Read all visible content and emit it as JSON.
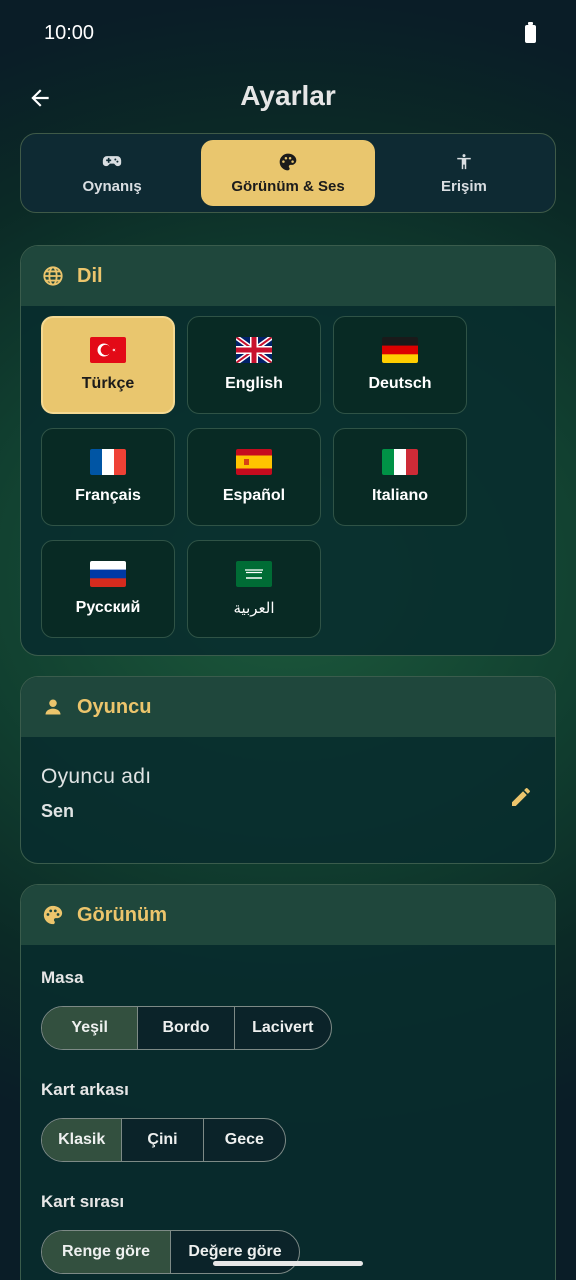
{
  "status_bar": {
    "time": "10:00"
  },
  "header": {
    "title": "Ayarlar",
    "back_icon": "arrow-left-icon"
  },
  "tabs": [
    {
      "label": "Oynanış",
      "icon": "gamepad-icon",
      "active": false
    },
    {
      "label": "Görünüm & Ses",
      "icon": "palette-icon",
      "active": true
    },
    {
      "label": "Erişim",
      "icon": "accessibility-icon",
      "active": false
    }
  ],
  "language": {
    "title": "Dil",
    "icon": "globe-icon",
    "items": [
      {
        "label": "Türkçe",
        "flag": "turkey-flag",
        "active": true
      },
      {
        "label": "English",
        "flag": "uk-flag",
        "active": false
      },
      {
        "label": "Deutsch",
        "flag": "germany-flag",
        "active": false
      },
      {
        "label": "Français",
        "flag": "france-flag",
        "active": false
      },
      {
        "label": "Español",
        "flag": "spain-flag",
        "active": false
      },
      {
        "label": "Italiano",
        "flag": "italy-flag",
        "active": false
      },
      {
        "label": "Русский",
        "flag": "russia-flag",
        "active": false
      },
      {
        "label": "العربية",
        "flag": "saudi-flag",
        "active": false
      }
    ]
  },
  "player": {
    "title": "Oyuncu",
    "icon": "person-icon",
    "name_label": "Oyuncu adı",
    "name_value": "Sen",
    "edit_icon": "pencil-icon"
  },
  "appearance": {
    "title": "Görünüm",
    "icon": "palette-icon",
    "table": {
      "label": "Masa",
      "options": [
        "Yeşil",
        "Bordo",
        "Lacivert"
      ],
      "selected": "Yeşil"
    },
    "card_back": {
      "label": "Kart arkası",
      "options": [
        "Klasik",
        "Çini",
        "Gece"
      ],
      "selected": "Klasik"
    },
    "card_order": {
      "label": "Kart sırası",
      "options": [
        "Renge göre",
        "Değere göre"
      ],
      "selected": "Renge göre"
    }
  },
  "colors": {
    "accent": "#e9c66e",
    "accent_text": "#ecc56c",
    "background": "#114030",
    "card_header": "#1f473c",
    "segment_active": "#33503f"
  }
}
